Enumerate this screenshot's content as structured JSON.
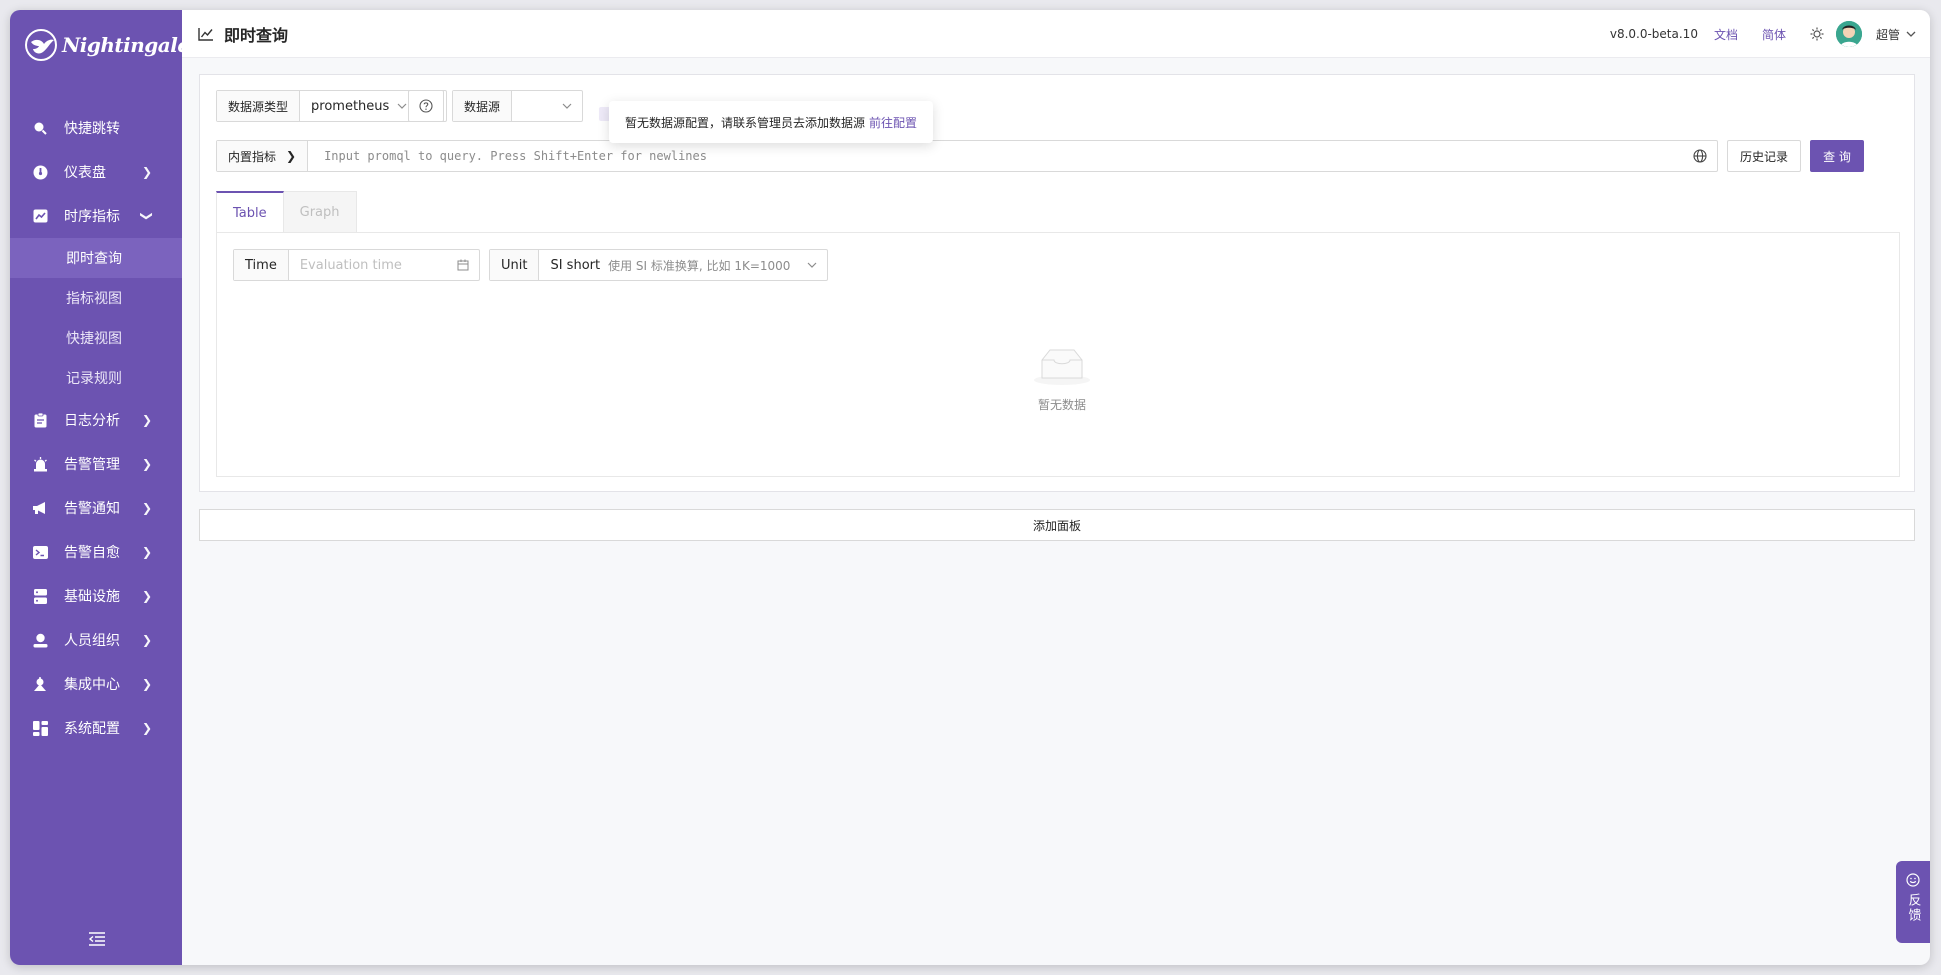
{
  "app": {
    "name": "Nightingale"
  },
  "sidebar": {
    "items": [
      {
        "label": "快捷跳转",
        "icon": "search-icon",
        "chevron": false
      },
      {
        "label": "仪表盘",
        "icon": "dashboard-icon",
        "chevron": "right"
      },
      {
        "label": "时序指标",
        "icon": "chart-line-icon",
        "chevron": "down",
        "children": [
          {
            "label": "即时查询",
            "active": true
          },
          {
            "label": "指标视图"
          },
          {
            "label": "快捷视图"
          },
          {
            "label": "记录规则"
          }
        ]
      },
      {
        "label": "日志分析",
        "icon": "clipboard-icon",
        "chevron": "right"
      },
      {
        "label": "告警管理",
        "icon": "siren-icon",
        "chevron": "right"
      },
      {
        "label": "告警通知",
        "icon": "megaphone-icon",
        "chevron": "right"
      },
      {
        "label": "告警自愈",
        "icon": "terminal-icon",
        "chevron": "right"
      },
      {
        "label": "基础设施",
        "icon": "server-icon",
        "chevron": "right"
      },
      {
        "label": "人员组织",
        "icon": "user-icon",
        "chevron": "right"
      },
      {
        "label": "集成中心",
        "icon": "integration-icon",
        "chevron": "right"
      },
      {
        "label": "系统配置",
        "icon": "settings-grid-icon",
        "chevron": "right"
      }
    ]
  },
  "header": {
    "title": "即时查询",
    "version": "v8.0.0-beta.10",
    "docs_label": "文档",
    "lang_label": "简体",
    "user_name": "超管"
  },
  "query": {
    "datasource_type_label": "数据源类型",
    "datasource_type_value": "prometheus",
    "datasource_label": "数据源",
    "datasource_value": "",
    "popover_text": "暂无数据源配置，请联系管理员去添加数据源",
    "popover_link": "前往配置",
    "builtin_metrics_label": "内置指标",
    "promql_placeholder": "Input promql to query. Press Shift+Enter for newlines",
    "history_label": "历史记录",
    "query_button": "查 询"
  },
  "tabs": [
    {
      "label": "Table",
      "active": true
    },
    {
      "label": "Graph",
      "active": false
    }
  ],
  "table_controls": {
    "time_label": "Time",
    "time_placeholder": "Evaluation time",
    "unit_label": "Unit",
    "unit_value": "SI short",
    "unit_hint": "使用 SI 标准换算, 比如 1K=1000"
  },
  "empty_text": "暂无数据",
  "add_panel_label": "添加面板",
  "feedback_label": "反馈",
  "colors": {
    "primary": "#6c53b1",
    "sidebar_active": "#7b63be"
  }
}
